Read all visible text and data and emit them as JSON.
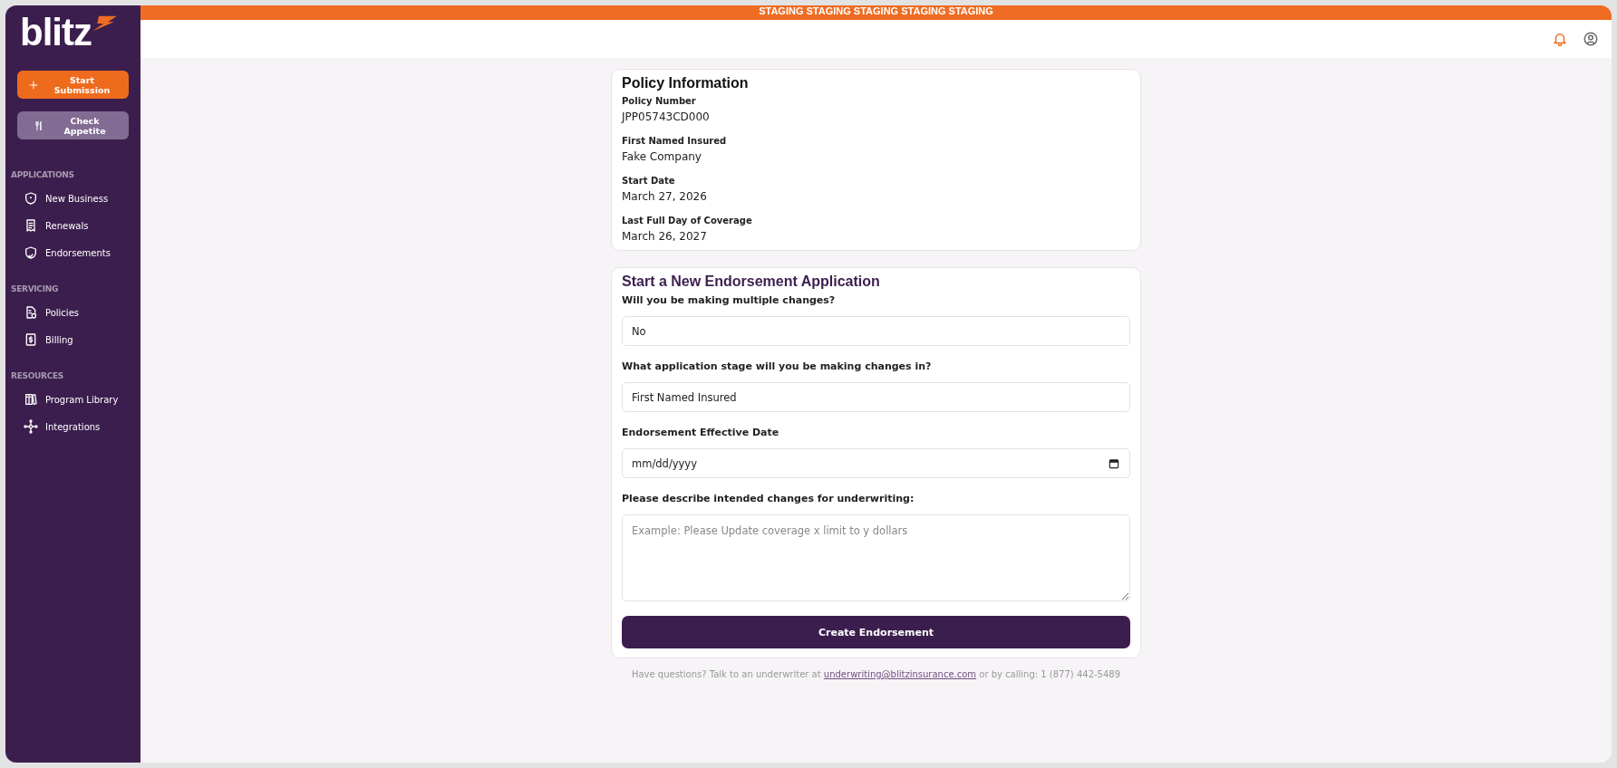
{
  "staging_banner": "STAGING STAGING STAGING STAGING STAGING",
  "logo": "blitz",
  "sidebar": {
    "buttons": [
      {
        "kind": "primary",
        "label": "Start Submission"
      },
      {
        "kind": "secondary",
        "label": "Check Appetite"
      }
    ],
    "sections": [
      {
        "title": "APPLICATIONS",
        "items": [
          {
            "label": "New Business"
          },
          {
            "label": "Renewals"
          },
          {
            "label": "Endorsements"
          }
        ]
      },
      {
        "title": "SERVICING",
        "items": [
          {
            "label": "Policies"
          },
          {
            "label": "Billing"
          }
        ]
      },
      {
        "title": "RESOURCES",
        "items": [
          {
            "label": "Program Library"
          },
          {
            "label": "Integrations"
          }
        ]
      }
    ]
  },
  "policy_card": {
    "title": "Policy Information",
    "fields": [
      {
        "label": "Policy Number",
        "value": "JPP05743CD000"
      },
      {
        "label": "First Named Insured",
        "value": "Fake Company"
      },
      {
        "label": "Start Date",
        "value": "March 27, 2026"
      },
      {
        "label": "Last Full Day of Coverage",
        "value": "March 26, 2027"
      }
    ]
  },
  "endorsement_card": {
    "title": "Start a New Endorsement Application",
    "fields": [
      {
        "kind": "select",
        "label": "Will you be making multiple changes?",
        "value": "No"
      },
      {
        "kind": "select",
        "label": "What application stage will you be making changes in?",
        "value": "First Named Insured"
      },
      {
        "kind": "date",
        "label": "Endorsement Effective Date",
        "placeholder": "mm/dd/yyyy"
      },
      {
        "kind": "textarea",
        "label": "Please describe intended changes for underwriting:",
        "placeholder": "Example: Please Update coverage x limit to y dollars"
      }
    ],
    "submit": "Create Endorsement"
  },
  "footer": {
    "text_before": "Have questions? Talk to an underwriter at",
    "email": "underwriting@blitzinsurance.com",
    "text_after": "or by calling: 1 (877) 442-5489"
  }
}
